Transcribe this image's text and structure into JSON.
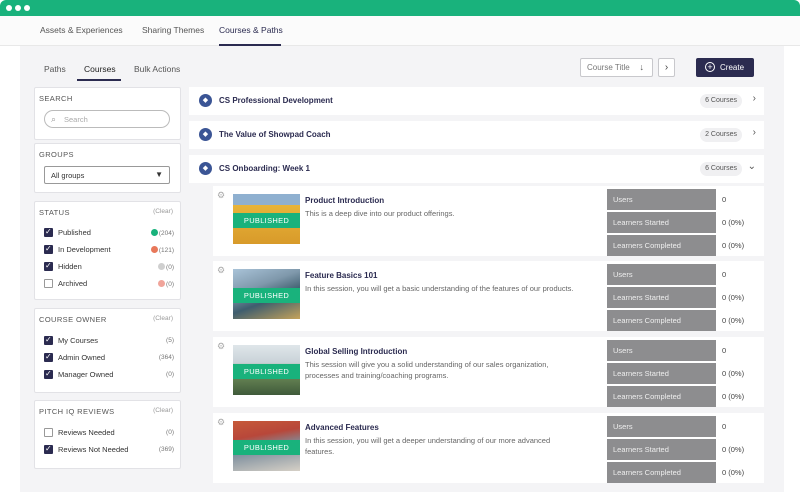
{
  "top_tabs": [
    "Assets & Experiences",
    "Sharing Themes",
    "Courses & Paths"
  ],
  "sub_tabs": [
    "Paths",
    "Courses",
    "Bulk Actions"
  ],
  "toolbar": {
    "sort_label": "Course Title",
    "sort_icon": "↓",
    "next_icon": "›",
    "create_label": "Create",
    "create_icon": "+"
  },
  "search": {
    "heading": "SEARCH",
    "placeholder": "Search"
  },
  "groups": {
    "heading": "GROUPS",
    "selected": "All groups"
  },
  "status": {
    "heading": "STATUS",
    "clear": "(Clear)",
    "items": [
      {
        "label": "Published",
        "count": "(204)",
        "checked": true,
        "dot_color": "#19b27c"
      },
      {
        "label": "In Development",
        "count": "(121)",
        "checked": true,
        "dot_color": "#e8785a"
      },
      {
        "label": "Hidden",
        "count": "(0)",
        "checked": true,
        "dot_color": "#cfcfcf"
      },
      {
        "label": "Archived",
        "count": "(0)",
        "checked": false,
        "dot_color": "#f0a49a"
      }
    ]
  },
  "course_owner": {
    "heading": "COURSE OWNER",
    "clear": "(Clear)",
    "items": [
      {
        "label": "My Courses",
        "count": "(5)",
        "checked": true
      },
      {
        "label": "Admin Owned",
        "count": "(364)",
        "checked": true
      },
      {
        "label": "Manager Owned",
        "count": "(0)",
        "checked": true
      }
    ]
  },
  "pitch_iq": {
    "heading": "PITCH IQ REVIEWS",
    "clear": "(Clear)",
    "items": [
      {
        "label": "Reviews Needed",
        "count": "(0)",
        "checked": false
      },
      {
        "label": "Reviews Not Needed",
        "count": "(369)",
        "checked": true
      }
    ]
  },
  "collections": [
    {
      "name": "CS Professional Development",
      "count": "6 Courses",
      "chevron": "›"
    },
    {
      "name": "The Value of Showpad Coach",
      "count": "2 Courses",
      "chevron": "›"
    },
    {
      "name": "CS Onboarding: Week 1",
      "count": "6 Courses",
      "chevron": "⌄"
    }
  ],
  "courses": [
    {
      "title": "Product Introduction",
      "desc": "This is a deep dive into our product offerings.",
      "badge": "PUBLISHED",
      "stats": [
        {
          "label": "Users",
          "value": "0"
        },
        {
          "label": "Learners Started",
          "value": "0 (0%)"
        },
        {
          "label": "Learners Completed",
          "value": "0 (0%)"
        }
      ]
    },
    {
      "title": "Feature Basics 101",
      "desc": "In this session, you will get a basic understanding of the features of our products.",
      "badge": "PUBLISHED",
      "stats": [
        {
          "label": "Users",
          "value": "0"
        },
        {
          "label": "Learners Started",
          "value": "0 (0%)"
        },
        {
          "label": "Learners Completed",
          "value": "0 (0%)"
        }
      ]
    },
    {
      "title": "Global Selling Introduction",
      "desc": "This session will give you a solid understanding of our sales organization, processes and training/coaching programs.",
      "badge": "PUBLISHED",
      "stats": [
        {
          "label": "Users",
          "value": "0"
        },
        {
          "label": "Learners Started",
          "value": "0 (0%)"
        },
        {
          "label": "Learners Completed",
          "value": "0 (0%)"
        }
      ]
    },
    {
      "title": "Advanced Features",
      "desc": "In this session, you will get a deeper understanding of our more advanced features.",
      "badge": "PUBLISHED",
      "stats": [
        {
          "label": "Users",
          "value": "0"
        },
        {
          "label": "Learners Started",
          "value": "0 (0%)"
        },
        {
          "label": "Learners Completed",
          "value": "0 (0%)"
        }
      ]
    }
  ]
}
